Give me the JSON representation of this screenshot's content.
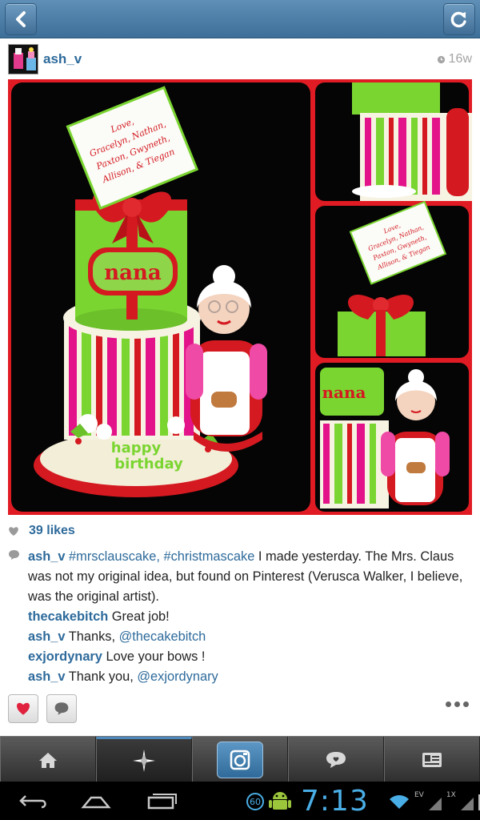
{
  "colors": {
    "accent": "#2d6a9b",
    "topbar": "#4a7ca6",
    "photo_border": "#e11b23",
    "clock": "#4aaee6"
  },
  "topbar": {
    "back_icon": "chevron-left-icon",
    "refresh_icon": "refresh-icon"
  },
  "post": {
    "username": "ash_v",
    "time_ago": "16w",
    "photo": {
      "tags": {
        "nana": "nana",
        "happy": "happy",
        "birthday": "birthday",
        "card_lines": [
          "Love,",
          "Gracelyn, Nathan,",
          "Paxton, Gwyneth,",
          "Allison, & Tiegan"
        ]
      }
    },
    "likes": "39 likes",
    "comments": [
      {
        "user": "ash_v",
        "tags": "#mrsclauscake, #christmascake",
        "text": " I made yesterday. The Mrs. Claus was not my original idea, but found on Pinterest (Verusca Walker, I believe, was the original artist)."
      },
      {
        "user": "thecakebitch",
        "tags": "",
        "text": " Great job!"
      },
      {
        "user": "ash_v",
        "tags": "",
        "pre": " Thanks, ",
        "mention": "@thecakebitch"
      },
      {
        "user": "exjordynary",
        "tags": "",
        "text": " Love your bows !"
      },
      {
        "user": "ash_v",
        "tags": "",
        "pre": " Thank you, ",
        "mention": "@exjordynary"
      }
    ]
  },
  "tabs": [
    "home-icon",
    "explore-icon",
    "camera-icon",
    "activity-icon",
    "profile-icon"
  ],
  "system": {
    "clock": "7:13",
    "notification_count": "60",
    "network": "EV",
    "sim": "1X"
  }
}
